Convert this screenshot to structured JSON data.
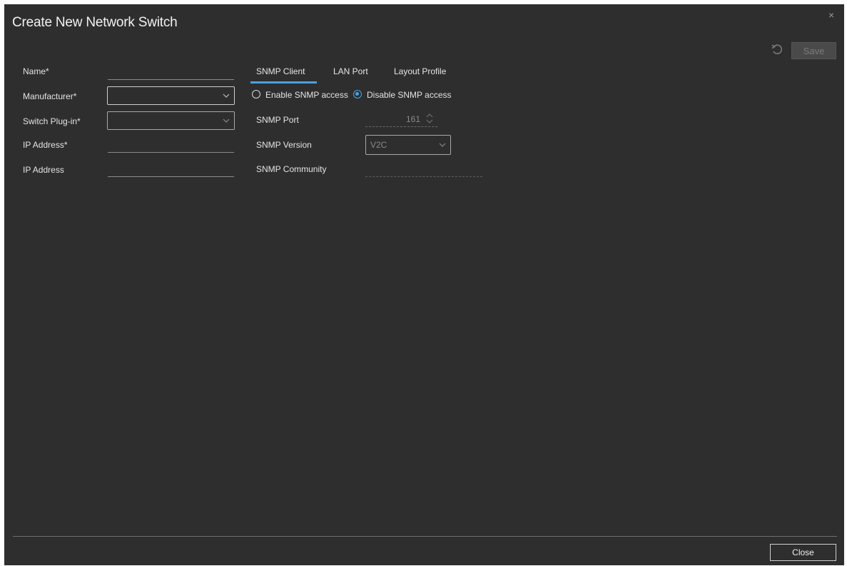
{
  "dialog": {
    "title": "Create New Network Switch",
    "close_glyph": "×",
    "save_label": "Save",
    "close_label": "Close"
  },
  "form": {
    "name": {
      "label": "Name*",
      "value": ""
    },
    "manufacturer": {
      "label": "Manufacturer*",
      "value": ""
    },
    "switch_plugin": {
      "label": "Switch Plug-in*",
      "value": ""
    },
    "ip_address_primary": {
      "label": "IP Address*",
      "value": ""
    },
    "ip_address_secondary": {
      "label": "IP Address",
      "value": ""
    }
  },
  "tabs": [
    {
      "label": "SNMP Client",
      "active": true
    },
    {
      "label": "LAN Port",
      "active": false
    },
    {
      "label": "Layout Profile",
      "active": false
    }
  ],
  "snmp": {
    "enable_label": "Enable SNMP access",
    "disable_label": "Disable SNMP access",
    "selected": "disable",
    "port_label": "SNMP Port",
    "port_value": "161",
    "version_label": "SNMP Version",
    "version_value": "V2C",
    "community_label": "SNMP Community",
    "community_value": ""
  },
  "colors": {
    "dialog_bg": "#2e2e2e",
    "accent": "#4aa3e0",
    "text": "#e6e6e6",
    "disabled_text": "#8a8a8a"
  },
  "icons": {
    "undo": "undo-icon",
    "close": "close-icon",
    "chevron": "chevron-down-icon",
    "spinner": "spinner-arrows-icon"
  }
}
